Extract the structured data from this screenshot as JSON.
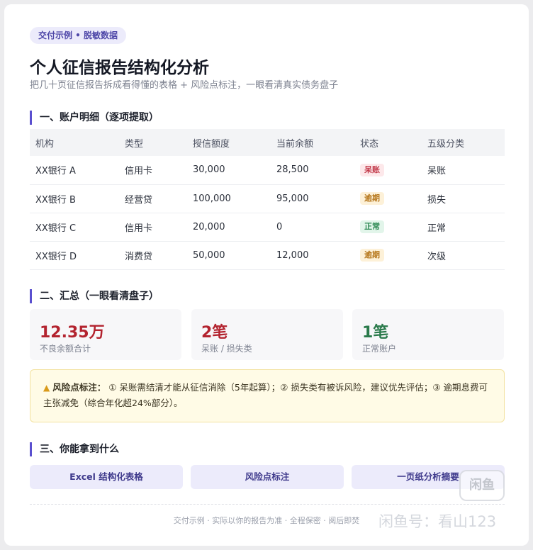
{
  "badge": "交付示例 • 脱敏数据",
  "title": "个人征信报告结构化分析",
  "subtitle": "把几十页征信报告拆成看得懂的表格 + 风险点标注，一眼看清真实债务盘子",
  "section1": {
    "title": "一、账户明细（逐项提取）"
  },
  "table": {
    "headers": [
      "机构",
      "类型",
      "授信额度",
      "当前余额",
      "状态",
      "五级分类"
    ],
    "rows": [
      {
        "org": "XX银行 A",
        "type": "信用卡",
        "credit": "30,000",
        "balance": "28,500",
        "status": "呆账",
        "status_bg": "#fde8ea",
        "status_fg": "#c23a4a",
        "grade": "呆账"
      },
      {
        "org": "XX银行 B",
        "type": "经营贷",
        "credit": "100,000",
        "balance": "95,000",
        "status": "逾期",
        "status_bg": "#fdf1d8",
        "status_fg": "#b7791f",
        "grade": "损失"
      },
      {
        "org": "XX银行 C",
        "type": "信用卡",
        "credit": "20,000",
        "balance": "0",
        "status": "正常",
        "status_bg": "#e2f5ea",
        "status_fg": "#2f8a55",
        "grade": "正常"
      },
      {
        "org": "XX银行 D",
        "type": "消费贷",
        "credit": "50,000",
        "balance": "12,000",
        "status": "逾期",
        "status_bg": "#fdf1d8",
        "status_fg": "#b7791f",
        "grade": "次级"
      }
    ]
  },
  "section2": {
    "title": "二、汇总（一眼看清盘子）"
  },
  "kpis": [
    {
      "value": "12.35万",
      "label": "不良余额合计",
      "color": "#b3232f"
    },
    {
      "value": "2笔",
      "label": "呆账 / 损失类",
      "color": "#b3232f"
    },
    {
      "value": "1笔",
      "label": "正常账户",
      "color": "#2a7a4b"
    }
  ],
  "alert": {
    "icon": "warning-icon",
    "label": "风险点标注：",
    "text": "① 呆账需结清才能从征信消除（5年起算）；② 损失类有被诉风险，建议优先评估；③ 逾期息费可主张减免（综合年化超24%部分）。"
  },
  "section3": {
    "title": "三、你能拿到什么"
  },
  "deliverables": [
    "Excel 结构化表格",
    "风险点标注",
    "一页纸分析摘要"
  ],
  "footer": "交付示例 · 实际以你的报告为准 · 全程保密 · 阅后即焚",
  "watermark": {
    "logo": "闲鱼",
    "text": "闲鱼号：看山123"
  },
  "colors": {
    "accent": "#5a4fcf",
    "danger": "#b3232f",
    "success": "#2a7a4b",
    "warning_bg": "#fffbe6"
  }
}
